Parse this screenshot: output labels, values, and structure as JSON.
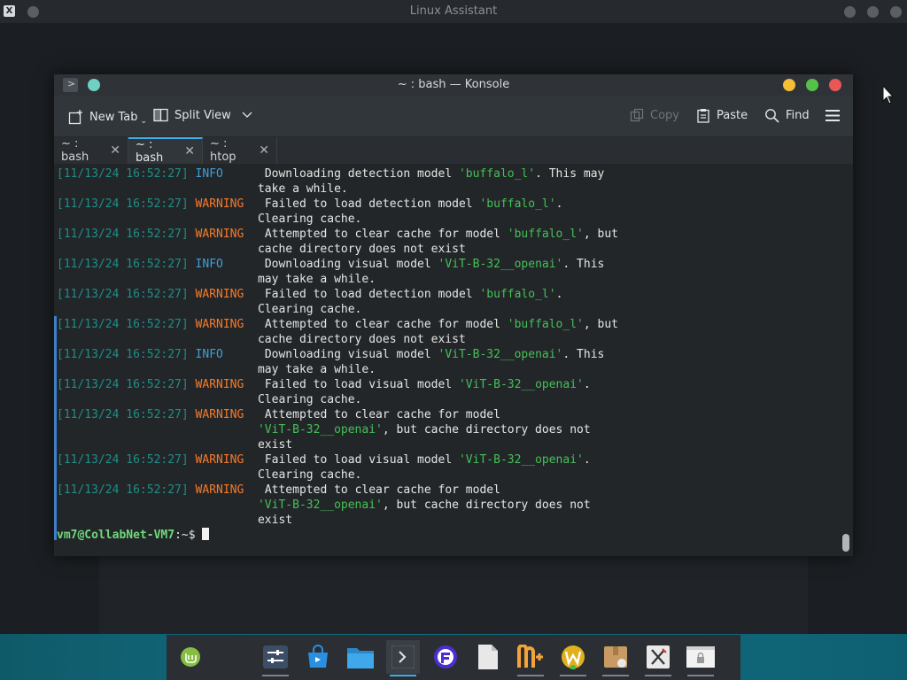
{
  "outer_window": {
    "title": "Linux Assistant",
    "app_icon": "X"
  },
  "konsole": {
    "title": "~ : bash — Konsole",
    "buttons": {
      "minimize_color": "#f4bf37",
      "maximize_color": "#56c14a",
      "close_color": "#eb5757"
    },
    "toolbar": {
      "new_tab": "New Tab",
      "split_view": "Split View",
      "copy": "Copy",
      "paste": "Paste",
      "find": "Find"
    },
    "tabs": [
      {
        "label": "~ : bash",
        "active": false
      },
      {
        "label": "~ : bash",
        "active": true
      },
      {
        "label": "~ : htop",
        "active": false
      }
    ],
    "log": [
      {
        "ts": "[11/13/24 16:52:27]",
        "level": "INFO",
        "l1a": "Downloading detection model ",
        "q1": "'buffalo_l'",
        "l1b": ". This may",
        "l2a": "take a while.",
        "q2": "",
        "l2b": "",
        "l3": ""
      },
      {
        "ts": "[11/13/24 16:52:27]",
        "level": "WARNING",
        "l1a": "Failed to load detection model ",
        "q1": "'buffalo_l'",
        "l1b": ".",
        "l2a": "Clearing cache.",
        "q2": "",
        "l2b": "",
        "l3": ""
      },
      {
        "ts": "[11/13/24 16:52:27]",
        "level": "WARNING",
        "l1a": "Attempted to clear cache for model ",
        "q1": "'buffalo_l'",
        "l1b": ", but",
        "l2a": "cache directory does not exist",
        "q2": "",
        "l2b": "",
        "l3": ""
      },
      {
        "ts": "[11/13/24 16:52:27]",
        "level": "INFO",
        "l1a": "Downloading visual model ",
        "q1": "'ViT-B-32__openai'",
        "l1b": ". This",
        "l2a": "may take a while.",
        "q2": "",
        "l2b": "",
        "l3": ""
      },
      {
        "ts": "[11/13/24 16:52:27]",
        "level": "WARNING",
        "l1a": "Failed to load detection model ",
        "q1": "'buffalo_l'",
        "l1b": ".",
        "l2a": "Clearing cache.",
        "q2": "",
        "l2b": "",
        "l3": ""
      },
      {
        "ts": "[11/13/24 16:52:27]",
        "level": "WARNING",
        "l1a": "Attempted to clear cache for model ",
        "q1": "'buffalo_l'",
        "l1b": ", but",
        "l2a": "cache directory does not exist",
        "q2": "",
        "l2b": "",
        "l3": ""
      },
      {
        "ts": "[11/13/24 16:52:27]",
        "level": "INFO",
        "l1a": "Downloading visual model ",
        "q1": "'ViT-B-32__openai'",
        "l1b": ". This",
        "l2a": "may take a while.",
        "q2": "",
        "l2b": "",
        "l3": ""
      },
      {
        "ts": "[11/13/24 16:52:27]",
        "level": "WARNING",
        "l1a": "Failed to load visual model ",
        "q1": "'ViT-B-32__openai'",
        "l1b": ".",
        "l2a": "Clearing cache.",
        "q2": "",
        "l2b": "",
        "l3": ""
      },
      {
        "ts": "[11/13/24 16:52:27]",
        "level": "WARNING",
        "l1a": "Attempted to clear cache for model",
        "q1": "",
        "l1b": "",
        "l2a": "",
        "q2": "'ViT-B-32__openai'",
        "l2b": ", but cache directory does not",
        "l3": "exist"
      },
      {
        "ts": "[11/13/24 16:52:27]",
        "level": "WARNING",
        "l1a": "Failed to load visual model ",
        "q1": "'ViT-B-32__openai'",
        "l1b": ".",
        "l2a": "Clearing cache.",
        "q2": "",
        "l2b": "",
        "l3": ""
      },
      {
        "ts": "[11/13/24 16:52:27]",
        "level": "WARNING",
        "l1a": "Attempted to clear cache for model",
        "q1": "",
        "l1b": "",
        "l2a": "",
        "q2": "'ViT-B-32__openai'",
        "l2b": ", but cache directory does not",
        "l3": "exist"
      }
    ],
    "prompt": {
      "user_host": "vm7@CollabNet-VM7",
      "path": ":~$"
    }
  },
  "taskbar": {
    "items": [
      {
        "icon": "linux-mint-icon"
      },
      {
        "icon": "system-settings-icon"
      },
      {
        "icon": "software-store-icon"
      },
      {
        "icon": "files-icon"
      },
      {
        "icon": "terminal-icon"
      },
      {
        "icon": "browser-icon"
      },
      {
        "icon": "text-editor-icon"
      },
      {
        "icon": "nplus-icon"
      },
      {
        "icon": "w-app-icon"
      },
      {
        "icon": "archive-icon"
      },
      {
        "icon": "x-app-icon"
      },
      {
        "icon": "lock-window-icon"
      }
    ]
  },
  "colors": {
    "accent": "#3daee9",
    "info": "#3d9fd6",
    "warning": "#f47a2a",
    "string": "#44c056",
    "timestamp": "#1e8e88",
    "prompt": "#6fd97c"
  }
}
